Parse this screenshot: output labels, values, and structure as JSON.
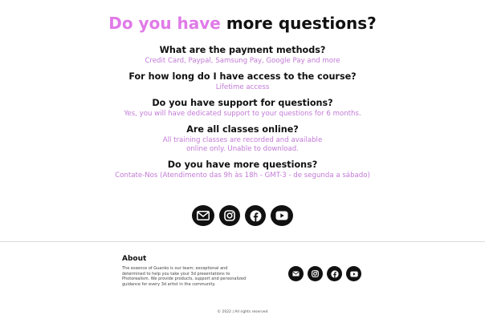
{
  "faq": {
    "title_accent": "Do you have",
    "title_rest": "more questions?",
    "items": [
      {
        "question": "What are the payment methods?",
        "answer": "Credit Card, Paypal, Samsung Pay, Google Pay and more"
      },
      {
        "question": "For how long do I have access to the course?",
        "answer": "Lifetime access"
      },
      {
        "question": "Do you have support for questions?",
        "answer": "Yes, you will have dedicated support to your questions for 6 months."
      },
      {
        "question": "Are all classes online?",
        "answer": "All training classes are recorded and available\nonline only. Unable to download."
      },
      {
        "question": "Do you have more questions?",
        "answer": "Contate-Nos (Atendimento das 9h às 18h - GMT-3 - de segunda a sábado)"
      }
    ]
  },
  "social": {
    "icons": [
      "email-icon",
      "instagram-icon",
      "facebook-icon",
      "youtube-icon"
    ]
  },
  "footer": {
    "about_title": "About",
    "about_text": "The essence of Guanko is our team; exceptional and determined to help you take your 3d presentations to Photorealism. We provide products, support and personalized guidance for every 3d artist in the community.",
    "copyright": "© 2022 | All rights reserved"
  },
  "colors": {
    "accent": "#e07ae8",
    "answer": "#c27ad6",
    "icon_bg": "#111111"
  }
}
